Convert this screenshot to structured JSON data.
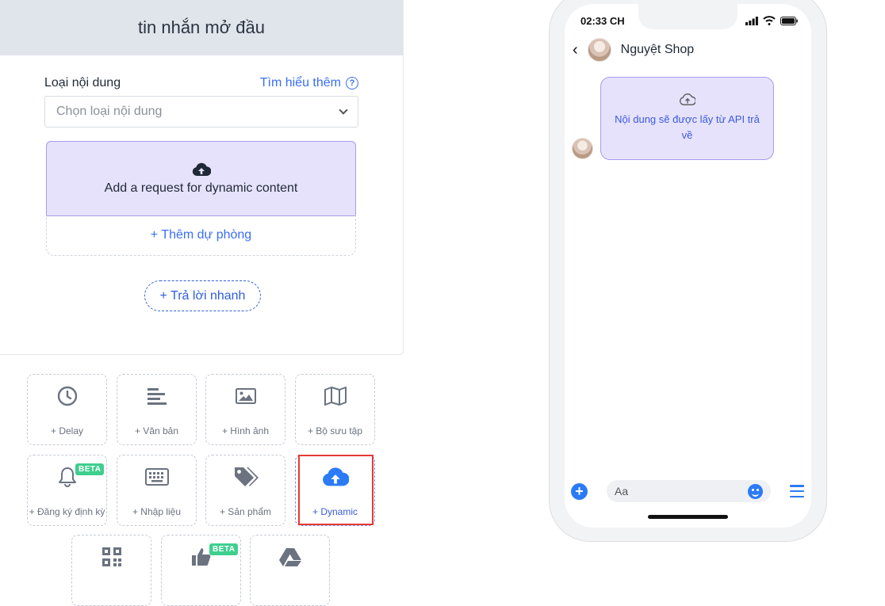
{
  "editor": {
    "title": "tin nhắn mở đầu",
    "content_type_label": "Loại nội dung",
    "learn_more": "Tìm hiểu thêm",
    "help_glyph": "?",
    "select_placeholder": "Chọn loại nội dung",
    "dynamic_request": "Add a request for dynamic content",
    "add_fallback": "+ Thêm dự phòng",
    "quick_reply": "+ Trả lời nhanh"
  },
  "tools": {
    "beta_badge": "BETA",
    "items": [
      {
        "label": "+ Delay",
        "icon": "clock-icon"
      },
      {
        "label": "+ Văn bản",
        "icon": "text-lines-icon"
      },
      {
        "label": "+ Hình ảnh",
        "icon": "image-icon"
      },
      {
        "label": "+ Bộ sưu tập",
        "icon": "map-gallery-icon"
      },
      {
        "label": "+ Đăng ký định kỳ",
        "icon": "bell-icon",
        "beta": true
      },
      {
        "label": "+ Nhập liệu",
        "icon": "keyboard-icon"
      },
      {
        "label": "+ Sản phẩm",
        "icon": "tags-icon"
      },
      {
        "label": "+ Dynamic",
        "icon": "cloud-upload-icon",
        "active": true
      },
      {
        "label": "",
        "icon": "qr-code-icon"
      },
      {
        "label": "",
        "icon": "thumbs-up-icon",
        "beta": true
      },
      {
        "label": "",
        "icon": "google-drive-icon"
      }
    ]
  },
  "preview": {
    "time": "02:33 CH",
    "shop_name": "Nguyệt Shop",
    "back_glyph": "‹",
    "bubble_text": "Nội dung sẽ được lấy từ API trả về",
    "input_placeholder": "Aa",
    "plus_glyph": "+"
  },
  "colors": {
    "accent_blue": "#3b6ef5",
    "dynamic_bg": "#e6e2fc",
    "beta_green": "#3ecf8e",
    "highlight_red": "#e53935",
    "messenger_blue": "#2b7bf6"
  }
}
